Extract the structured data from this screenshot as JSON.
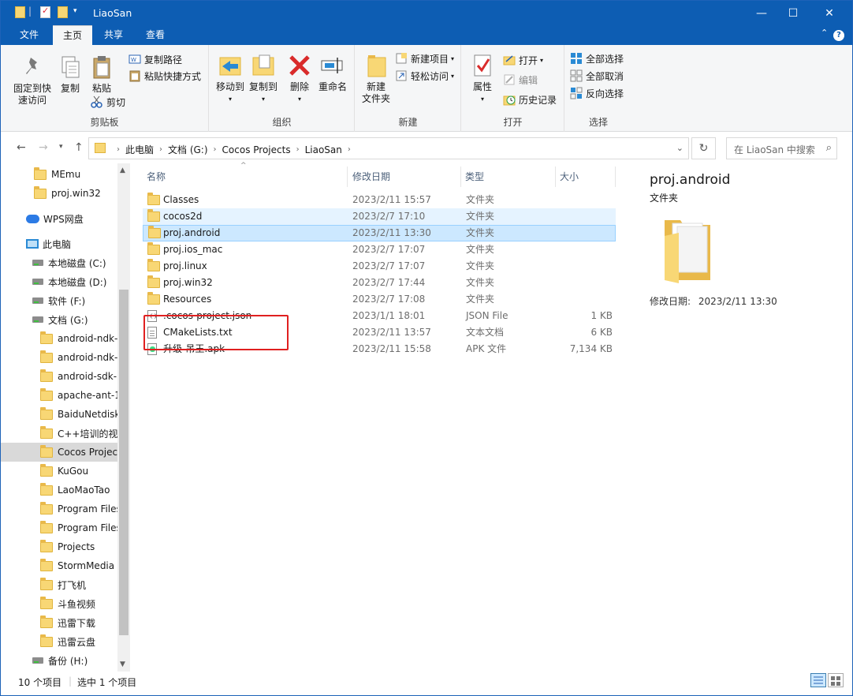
{
  "window": {
    "title": "LiaoSan",
    "accent": "#0d5db3"
  },
  "tabs": [
    {
      "label": "文件"
    },
    {
      "label": "主页"
    },
    {
      "label": "共享"
    },
    {
      "label": "查看"
    }
  ],
  "ribbon": {
    "clipboard": {
      "label": "剪贴板",
      "pin": "固定到快速访问",
      "pin_line1": "固定到快",
      "pin_line2": "速访问",
      "copy": "复制",
      "paste": "粘贴",
      "copy_path": "复制路径",
      "paste_shortcut": "粘贴快捷方式",
      "cut": "剪切"
    },
    "organize": {
      "label": "组织",
      "move_to": "移动到",
      "copy_to": "复制到",
      "delete": "删除",
      "rename": "重命名"
    },
    "new": {
      "label": "新建",
      "new_folder_line1": "新建",
      "new_folder_line2": "文件夹",
      "new_item": "新建项目",
      "easy_access": "轻松访问"
    },
    "open": {
      "label": "打开",
      "properties": "属性",
      "open": "打开",
      "edit": "编辑",
      "history": "历史记录"
    },
    "select": {
      "label": "选择",
      "select_all": "全部选择",
      "select_none": "全部取消",
      "invert": "反向选择"
    }
  },
  "address": {
    "crumbs": [
      "此电脑",
      "文档 (G:)",
      "Cocos Projects",
      "LiaoSan"
    ],
    "search_placeholder": "在 LiaoSan 中搜索"
  },
  "nav": {
    "items": [
      {
        "label": "MEmu",
        "icon": "folder-icon"
      },
      {
        "label": "proj.win32",
        "icon": "folder-icon"
      },
      {
        "label": "WPS网盘",
        "icon": "cloud-icon"
      },
      {
        "label": "此电脑",
        "icon": "pc-icon"
      },
      {
        "label": "本地磁盘 (C:)",
        "icon": "drive-icon"
      },
      {
        "label": "本地磁盘 (D:)",
        "icon": "drive-icon"
      },
      {
        "label": "软件 (F:)",
        "icon": "drive-icon"
      },
      {
        "label": "文档 (G:)",
        "icon": "drive-icon"
      },
      {
        "label": "android-ndk-",
        "icon": "folder-icon"
      },
      {
        "label": "android-ndk-",
        "icon": "folder-icon"
      },
      {
        "label": "android-sdk-",
        "icon": "folder-icon"
      },
      {
        "label": "apache-ant-1",
        "icon": "folder-icon"
      },
      {
        "label": "BaiduNetdisk",
        "icon": "folder-icon"
      },
      {
        "label": "C++培训的视频",
        "icon": "folder-icon"
      },
      {
        "label": "Cocos Project",
        "icon": "folder-icon"
      },
      {
        "label": "KuGou",
        "icon": "folder-icon"
      },
      {
        "label": "LaoMaoTao",
        "icon": "folder-icon"
      },
      {
        "label": "Program Files",
        "icon": "folder-icon"
      },
      {
        "label": "Program Files",
        "icon": "folder-icon"
      },
      {
        "label": "Projects",
        "icon": "folder-icon"
      },
      {
        "label": "StormMedia",
        "icon": "folder-icon"
      },
      {
        "label": "打飞机",
        "icon": "folder-icon"
      },
      {
        "label": "斗鱼视频",
        "icon": "folder-icon"
      },
      {
        "label": "迅雷下载",
        "icon": "folder-icon"
      },
      {
        "label": "迅雷云盘",
        "icon": "folder-icon"
      },
      {
        "label": "备份 (H:)",
        "icon": "drive-icon"
      }
    ]
  },
  "list": {
    "headers": {
      "name": "名称",
      "date": "修改日期",
      "type": "类型",
      "size": "大小"
    },
    "rows": [
      {
        "name": "Classes",
        "date": "2023/2/11 15:57",
        "type": "文件夹",
        "size": ""
      },
      {
        "name": "cocos2d",
        "date": "2023/2/7 17:10",
        "type": "文件夹",
        "size": ""
      },
      {
        "name": "proj.android",
        "date": "2023/2/11 13:30",
        "type": "文件夹",
        "size": ""
      },
      {
        "name": "proj.ios_mac",
        "date": "2023/2/7 17:07",
        "type": "文件夹",
        "size": ""
      },
      {
        "name": "proj.linux",
        "date": "2023/2/7 17:07",
        "type": "文件夹",
        "size": ""
      },
      {
        "name": "proj.win32",
        "date": "2023/2/7 17:44",
        "type": "文件夹",
        "size": ""
      },
      {
        "name": "Resources",
        "date": "2023/2/7 17:08",
        "type": "文件夹",
        "size": ""
      },
      {
        "name": ".cocos-project.json",
        "date": "2023/1/1 18:01",
        "type": "JSON File",
        "size": "1 KB"
      },
      {
        "name": "CMakeLists.txt",
        "date": "2023/2/11 13:57",
        "type": "文本文档",
        "size": "6 KB"
      },
      {
        "name": "升级-吊王.apk",
        "date": "2023/2/11 15:58",
        "type": "APK 文件",
        "size": "7,134 KB"
      }
    ]
  },
  "preview": {
    "title": "proj.android",
    "type": "文件夹",
    "date_label": "修改日期:",
    "date_value": "2023/2/11 13:30"
  },
  "status": {
    "count": "10 个项目",
    "selected": "选中 1 个项目"
  }
}
